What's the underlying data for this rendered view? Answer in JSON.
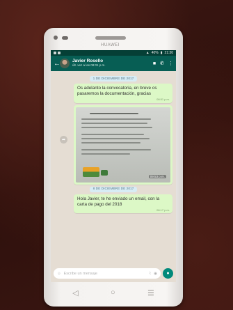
{
  "device": {
    "brand": "HUAWEI"
  },
  "statusbar": {
    "battery": "40%",
    "time": "21:30"
  },
  "chat_header": {
    "name": "Javier Rosello",
    "last_seen": "últ. vez a las 08:01 p.m.",
    "back_icon": "back-arrow-icon",
    "video_icon": "videocam-icon",
    "call_icon": "phone-icon",
    "menu_icon": "more-vert-icon"
  },
  "messages": [
    {
      "type": "date",
      "text": "1 DE DICIEMBRE DE 2017"
    },
    {
      "type": "text",
      "text": "Os adelanto la convocatoria, en breve os pasaremos la documentación, gracias",
      "time": "08:51 p.m."
    },
    {
      "type": "image",
      "time": "09:53 p.m."
    },
    {
      "type": "date",
      "text": "8 DE DICIEMBRE DE 2017"
    },
    {
      "type": "text",
      "text": "Hola Javier, te he enviado un email, con la carta de pago del 2018",
      "time": "06:17 p.m."
    }
  ],
  "input": {
    "placeholder": "Escribe un mensaje"
  },
  "navbar": {
    "back": "◁",
    "home": "○",
    "menu": "☰"
  },
  "colors": {
    "header": "#075e54",
    "bubble_out": "#dcf8c6",
    "chat_bg": "#e5ddd3",
    "accent": "#00897b"
  }
}
